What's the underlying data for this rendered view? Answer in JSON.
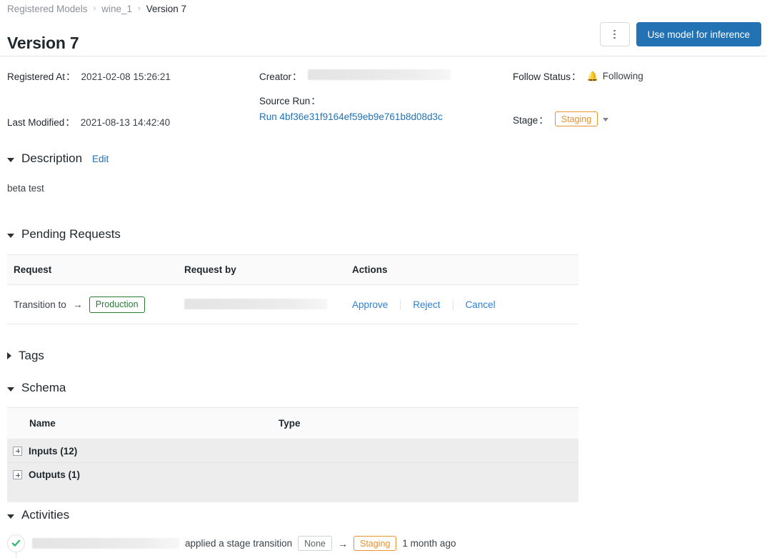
{
  "breadcrumb": {
    "items": [
      "Registered Models",
      "wine_1",
      "Version 7"
    ],
    "separator": "›"
  },
  "header": {
    "title": "Version 7",
    "kebab_label": "⋮",
    "primary_button": "Use model for inference"
  },
  "metadata": {
    "registered_at_label": "Registered At",
    "registered_at_value": "2021-02-08 15:26:21",
    "last_modified_label": "Last Modified",
    "last_modified_value": "2021-08-13 14:42:40",
    "creator_label": "Creator",
    "creator_value": "",
    "source_run_label": "Source Run",
    "source_run_value": "Run 4bf36e31f9164ef59eb9e761b8d08d3c",
    "follow_status_label": "Follow Status",
    "follow_status_value": "Following",
    "follow_icon": "bell-icon",
    "stage_label": "Stage",
    "stage_value": "Staging",
    "colon": "："
  },
  "description": {
    "title": "Description",
    "edit_label": "Edit",
    "body": "beta test"
  },
  "pending_requests": {
    "title": "Pending Requests",
    "columns": [
      "Request",
      "Request by",
      "Actions"
    ],
    "rows": [
      {
        "request_prefix": "Transition to",
        "request_arrow": "→",
        "request_stage": "Production",
        "requested_by": "",
        "actions": [
          "Approve",
          "Reject",
          "Cancel"
        ]
      }
    ]
  },
  "tags": {
    "title": "Tags"
  },
  "schema": {
    "title": "Schema",
    "columns": [
      "Name",
      "Type"
    ],
    "rows": [
      {
        "name": "Inputs (12)",
        "type": ""
      },
      {
        "name": "Outputs (1)",
        "type": ""
      }
    ]
  },
  "activities": {
    "title": "Activities",
    "entries": [
      {
        "user": "",
        "action": "applied a stage transition",
        "from_stage": "None",
        "arrow": "→",
        "to_stage": "Staging",
        "time": "1 month ago"
      }
    ]
  },
  "colors": {
    "primary": "#2272b4",
    "link": "#2e80d3",
    "staging": "#e8912d",
    "production": "#2a7a36",
    "check": "#2eb872"
  }
}
